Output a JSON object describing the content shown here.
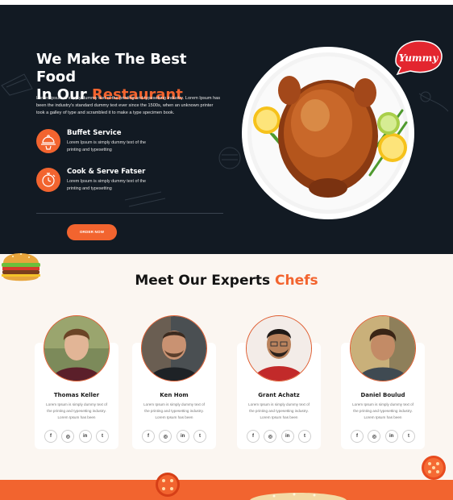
{
  "hero": {
    "title_line1": "We Make The Best Food",
    "title_line2_prefix": "In Our ",
    "title_line2_accent": "Restaurant",
    "description": "Lorem Ipsum is simply dummy text of the printing and typesetting industry. Lorem Ipsum has been the industry's standard dummy text ever since the 1500s, when an unknown printer took a galley of type and scrambled it to make a type specimen book.",
    "features": [
      {
        "title": "Buffet Service",
        "description": "Lorem Ipsum is simply dummy text of the printing and typesetting",
        "icon": "cloche-icon"
      },
      {
        "title": "Cook & Serve Fatser",
        "description": "Lorem Ipsum is simply dummy text of the printing and typesetting",
        "icon": "timer-icon"
      }
    ],
    "button_label": "ORDER NOW",
    "badge_text": "Yummy"
  },
  "chefs_section": {
    "title_prefix": "Meet Our Experts ",
    "title_accent": "Chefs",
    "chefs": [
      {
        "name": "Thomas Keller",
        "description": "Lorem Ipsum is simply dummy text of the printing and typesetting industry. Lorem Ipsum has been"
      },
      {
        "name": "Ken Hom",
        "description": "Lorem Ipsum is simply dummy text of the printing and typesetting industry. Lorem Ipsum has been"
      },
      {
        "name": "Grant Achatz",
        "description": "Lorem Ipsum is simply dummy text of the printing and typesetting industry. Lorem Ipsum has been"
      },
      {
        "name": "Daniel Boulud",
        "description": "Lorem Ipsum is simply dummy text of the printing and typesetting industry. Lorem Ipsum has been"
      }
    ],
    "social_icons": [
      "facebook-icon",
      "instagram-icon",
      "linkedin-icon",
      "twitter-icon"
    ]
  },
  "colors": {
    "accent": "#f2642f",
    "hero_bg": "#121a23",
    "page_bg": "#fbf6f1"
  }
}
